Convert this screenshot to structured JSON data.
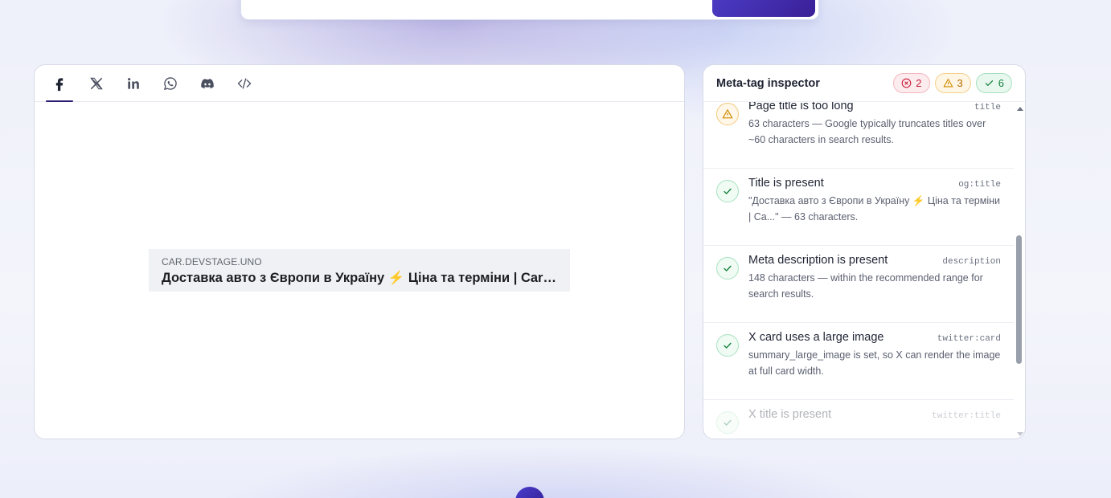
{
  "preview": {
    "tabs": [
      {
        "id": "facebook",
        "icon": "facebook-icon",
        "active": true
      },
      {
        "id": "x",
        "icon": "x-icon",
        "active": false
      },
      {
        "id": "linkedin",
        "icon": "linkedin-icon",
        "active": false
      },
      {
        "id": "whatsapp",
        "icon": "whatsapp-icon",
        "active": false
      },
      {
        "id": "discord",
        "icon": "discord-icon",
        "active": false
      },
      {
        "id": "code",
        "icon": "code-icon",
        "active": false
      }
    ],
    "link": {
      "domain": "CAR.DEVSTAGE.UNO",
      "title": "Доставка авто з Європи в Україну ⚡ Ціна та терміни | CarS..."
    }
  },
  "inspector": {
    "title": "Meta-tag inspector",
    "counts": {
      "errors": "2",
      "warnings": "3",
      "passed": "6"
    },
    "items": [
      {
        "status": "warn",
        "name": "Page title is too long",
        "tag": "title",
        "desc": "63 characters — Google typically truncates titles over ~60 characters in search results."
      },
      {
        "status": "ok",
        "name": "Title is present",
        "tag": "og:title",
        "desc": "\"Доставка авто з Європи в Україну ⚡ Ціна та терміни | Ca...\" — 63 characters."
      },
      {
        "status": "ok",
        "name": "Meta description is present",
        "tag": "description",
        "desc": "148 characters — within the recommended range for search results."
      },
      {
        "status": "ok",
        "name": "X card uses a large image",
        "tag": "twitter:card",
        "desc": "summary_large_image is set, so X can render the image at full card width."
      },
      {
        "status": "ok",
        "name": "X title is present",
        "tag": "twitter:title",
        "desc": ""
      }
    ]
  },
  "colors": {
    "accent": "#2d1b7a",
    "error": "#c81e3a",
    "warning": "#b46a00",
    "success": "#15803d"
  }
}
